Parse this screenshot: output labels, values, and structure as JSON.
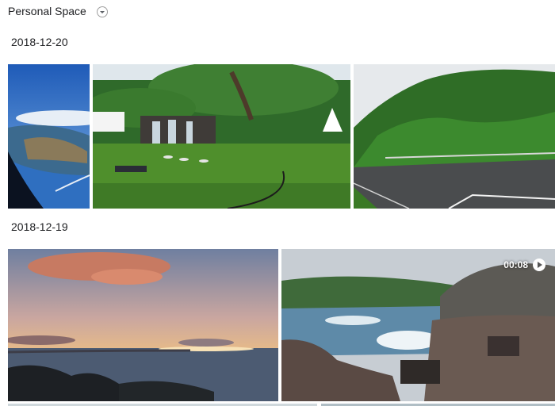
{
  "header": {
    "title": "Personal Space",
    "menu_icon": "chevron-down-icon"
  },
  "groups": [
    {
      "date": "2018-12-20",
      "photos": [
        {
          "type": "photo",
          "subject": "airplane-window-aerial"
        },
        {
          "type": "photo",
          "subject": "garden-waterfall"
        },
        {
          "type": "photo",
          "subject": "green-mountain-overlook"
        }
      ]
    },
    {
      "date": "2018-12-19",
      "photos": [
        {
          "type": "photo",
          "subject": "ocean-sunset"
        },
        {
          "type": "video",
          "duration": "00:08",
          "icon": "play-icon",
          "subject": "rocky-coast-waves"
        }
      ]
    }
  ]
}
